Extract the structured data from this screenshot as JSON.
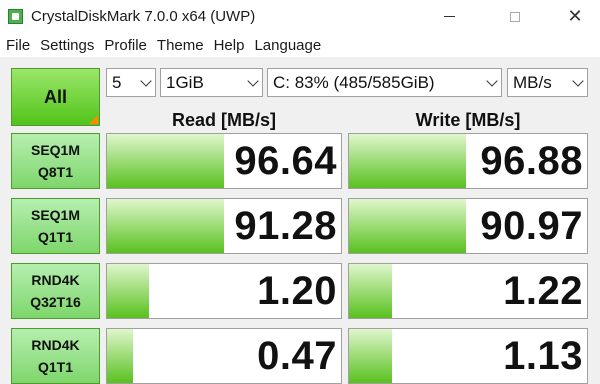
{
  "window": {
    "title": "CrystalDiskMark 7.0.0 x64 (UWP)",
    "close_glyph": "✕"
  },
  "menu": [
    "File",
    "Settings",
    "Profile",
    "Theme",
    "Help",
    "Language"
  ],
  "controls": {
    "all_label": "All",
    "count": "5",
    "size": "1GiB",
    "drive": "C: 83% (485/585GiB)",
    "unit": "MB/s"
  },
  "headers": {
    "read": "Read [MB/s]",
    "write": "Write [MB/s]"
  },
  "rows": [
    {
      "line1": "SEQ1M",
      "line2": "Q8T1",
      "read": "96.64",
      "write": "96.88",
      "read_fill": 0.5,
      "write_fill": 0.49
    },
    {
      "line1": "SEQ1M",
      "line2": "Q1T1",
      "read": "91.28",
      "write": "90.97",
      "read_fill": 0.5,
      "write_fill": 0.49
    },
    {
      "line1": "RND4K",
      "line2": "Q32T16",
      "read": "1.20",
      "write": "1.22",
      "read_fill": 0.18,
      "write_fill": 0.18
    },
    {
      "line1": "RND4K",
      "line2": "Q1T1",
      "read": "0.47",
      "write": "1.13",
      "read_fill": 0.11,
      "write_fill": 0.18
    }
  ],
  "colors": {
    "accent_green": "#52c41a",
    "corner_orange": "#ff8a00"
  }
}
